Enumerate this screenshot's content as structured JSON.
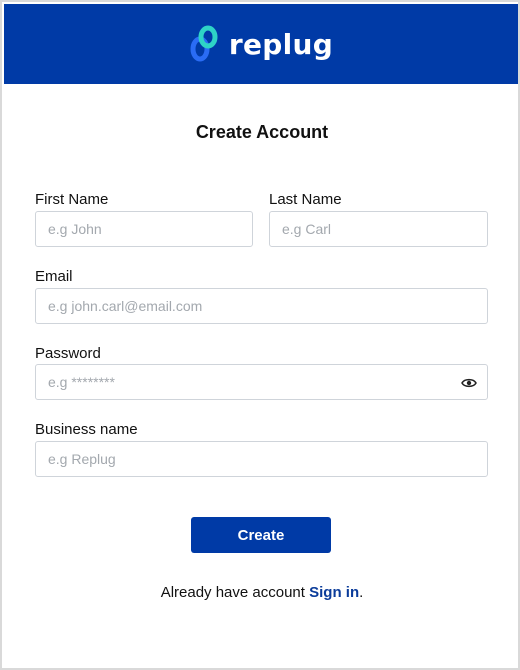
{
  "brand": {
    "name": "replug",
    "logo_icon": "chain-link-icon",
    "header_color": "#003aa6",
    "accent_color": "#2ed3c6"
  },
  "form": {
    "title": "Create Account",
    "first_name": {
      "label": "First Name",
      "placeholder": "e.g John"
    },
    "last_name": {
      "label": "Last Name",
      "placeholder": "e.g Carl"
    },
    "email": {
      "label": "Email",
      "placeholder": "e.g john.carl@email.com"
    },
    "password": {
      "label": "Password",
      "placeholder": "e.g ********",
      "toggle_icon": "eye-icon"
    },
    "business": {
      "label": "Business name",
      "placeholder": "e.g Replug"
    },
    "submit_label": "Create"
  },
  "footer": {
    "prompt": "Already have account ",
    "link": "Sign in",
    "suffix": "."
  }
}
